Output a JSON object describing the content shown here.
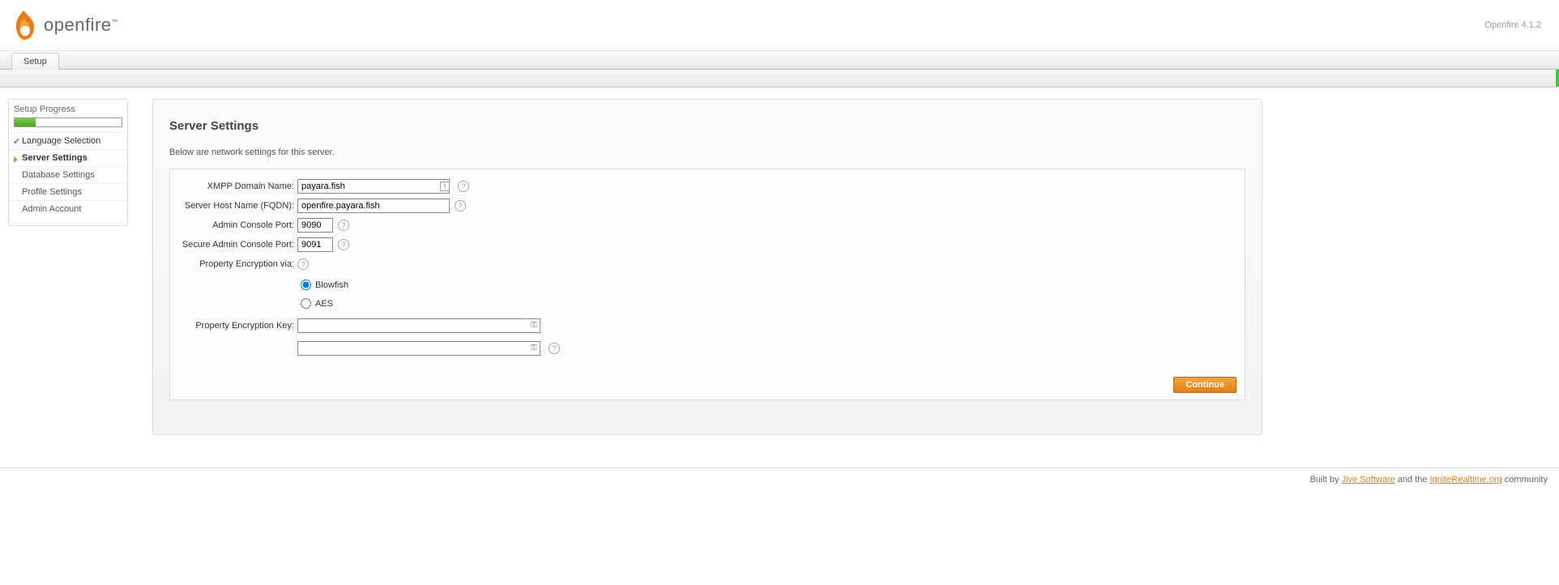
{
  "header": {
    "brand": "openfire",
    "version": "Openfire 4.1.2"
  },
  "tabs": {
    "setup": "Setup"
  },
  "sidebar": {
    "title": "Setup Progress",
    "progress_percent": 20,
    "steps": {
      "language": "Language Selection",
      "server": "Server Settings",
      "database": "Database Settings",
      "profile": "Profile Settings",
      "admin": "Admin Account"
    }
  },
  "page": {
    "title": "Server Settings",
    "description": "Below are network settings for this server."
  },
  "form": {
    "labels": {
      "xmpp_domain": "XMPP Domain Name:",
      "server_host": "Server Host Name (FQDN):",
      "admin_port": "Admin Console Port:",
      "secure_port": "Secure Admin Console Port:",
      "prop_enc_via": "Property Encryption via:",
      "prop_enc_key": "Property Encryption Key:"
    },
    "values": {
      "xmpp_domain": "payara.fish",
      "server_host": "openfire.payara.fish",
      "admin_port": "9090",
      "secure_port": "9091",
      "enc_key1": "",
      "enc_key2": ""
    },
    "radios": {
      "blowfish": "Blowfish",
      "aes": "AES"
    },
    "continue": "Continue"
  },
  "footer": {
    "built_by": "Built by ",
    "jive": "Jive Software",
    "and_the": " and the ",
    "ignite": "IgniteRealtime.org",
    "community": " community"
  }
}
